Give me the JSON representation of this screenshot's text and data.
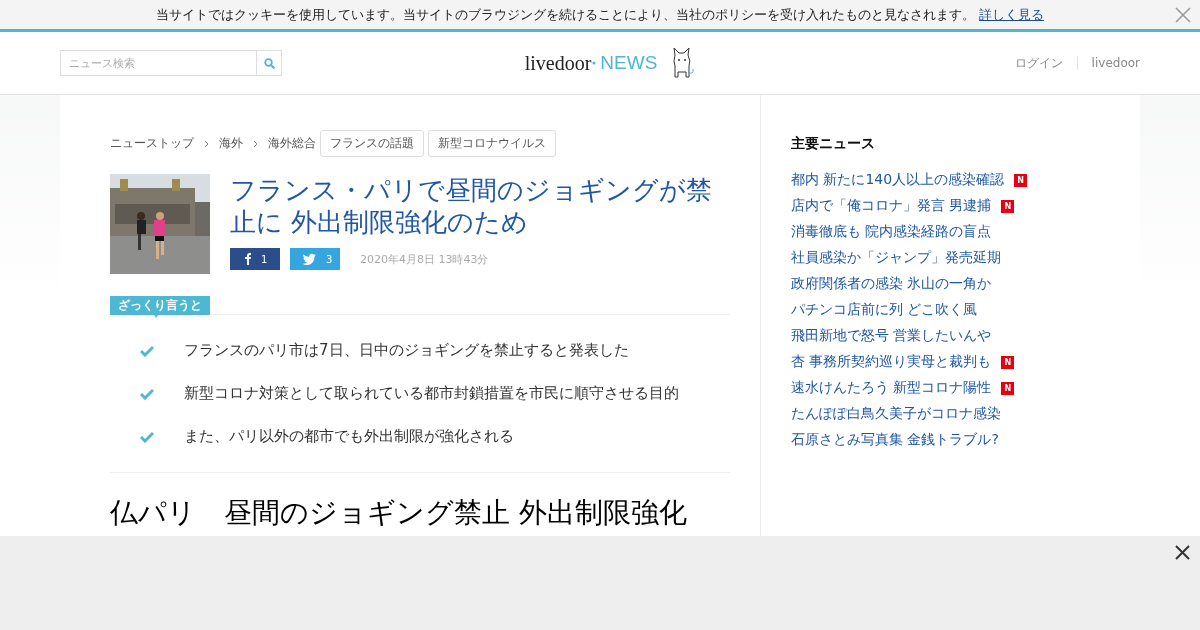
{
  "cookie_bar": {
    "message": "当サイトではクッキーを使用しています。当サイトのブラウジングを続けることにより、当社のポリシーを受け入れたものと見なされます。",
    "link": "詳しく見る"
  },
  "header": {
    "search": {
      "placeholder": "ニュース検索"
    },
    "logo": {
      "brand": "livedoor",
      "section": "NEWS"
    },
    "nav": [
      "ログイン",
      "livedoor"
    ]
  },
  "breadcrumbs": [
    "ニューストップ",
    "海外",
    "海外総合"
  ],
  "tags": [
    "フランスの話題",
    "新型コロナウイルス"
  ],
  "article": {
    "title": "フランス・パリで昼間のジョギングが禁止に 外出制限強化のため",
    "shares": [
      {
        "kind": "facebook",
        "count": "1"
      },
      {
        "kind": "twitter",
        "count": "3"
      }
    ],
    "date": "2020年4月8日 13時43分"
  },
  "summary": {
    "label": "ざっくり言うと",
    "points": [
      "フランスのパリ市は7日、日中のジョギングを禁止すると発表した",
      "新型コロナ対策として取られている都市封鎖措置を市民に順守させる目的",
      "また、パリ以外の都市でも外出制限が強化される"
    ]
  },
  "body_heading": "仏パリ　昼間のジョギング禁止 外出制限強化",
  "sidebar": {
    "title": "主要ニュース",
    "items": [
      {
        "text": "都内 新たに140人以上の感染確認",
        "new": true,
        "badge": "N"
      },
      {
        "text": "店内で「俺コロナ」発言 男逮捕",
        "new": true,
        "badge": "N"
      },
      {
        "text": "消毒徹底も 院内感染経路の盲点",
        "new": false
      },
      {
        "text": "社員感染か「ジャンプ」発売延期",
        "new": false
      },
      {
        "text": "政府関係者の感染 氷山の一角か",
        "new": false
      },
      {
        "text": "パチンコ店前に列 どこ吹く風",
        "new": false
      },
      {
        "text": "飛田新地で怒号 営業したいんや",
        "new": false
      },
      {
        "text": "杏 事務所契約巡り実母と裁判も",
        "new": true,
        "badge": "N"
      },
      {
        "text": "速水けんたろう 新型コロナ陽性",
        "new": true,
        "badge": "N"
      },
      {
        "text": "たんぽぽ白鳥久美子がコロナ感染",
        "new": false
      },
      {
        "text": "石原さとみ写真集 金銭トラブル?",
        "new": false
      }
    ]
  }
}
